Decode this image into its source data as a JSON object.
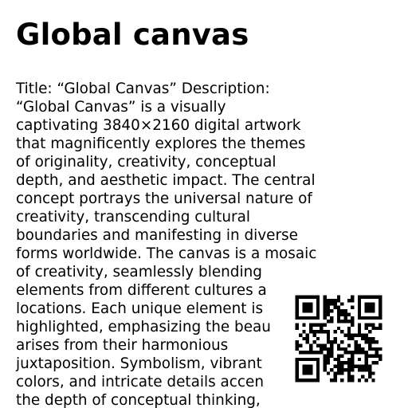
{
  "title": "Global canvas",
  "description_lines": [
    "Title: “Global Canvas” Description:",
    "“Global Canvas” is a visually",
    "captivating 3840×2160 digital artwork",
    "that magnificently explores the themes",
    "of originality, creativity, conceptual",
    "depth, and aesthetic impact. The central",
    "concept portrays the universal nature of",
    "creativity, transcending cultural",
    "boundaries and manifesting in diverse",
    "forms worldwide. The canvas is a mosaic",
    "of creativity, seamlessly blending",
    "elements from different cultures a",
    "locations. Each unique element is",
    "highlighted, emphasizing the beau",
    "arises from their harmonious",
    "juxtaposition. Symbolism, vibrant",
    "colors, and intricate details accen",
    "the depth of conceptual thinking,"
  ],
  "qr": {
    "icon": "qr-code-icon",
    "color": "#000000"
  }
}
